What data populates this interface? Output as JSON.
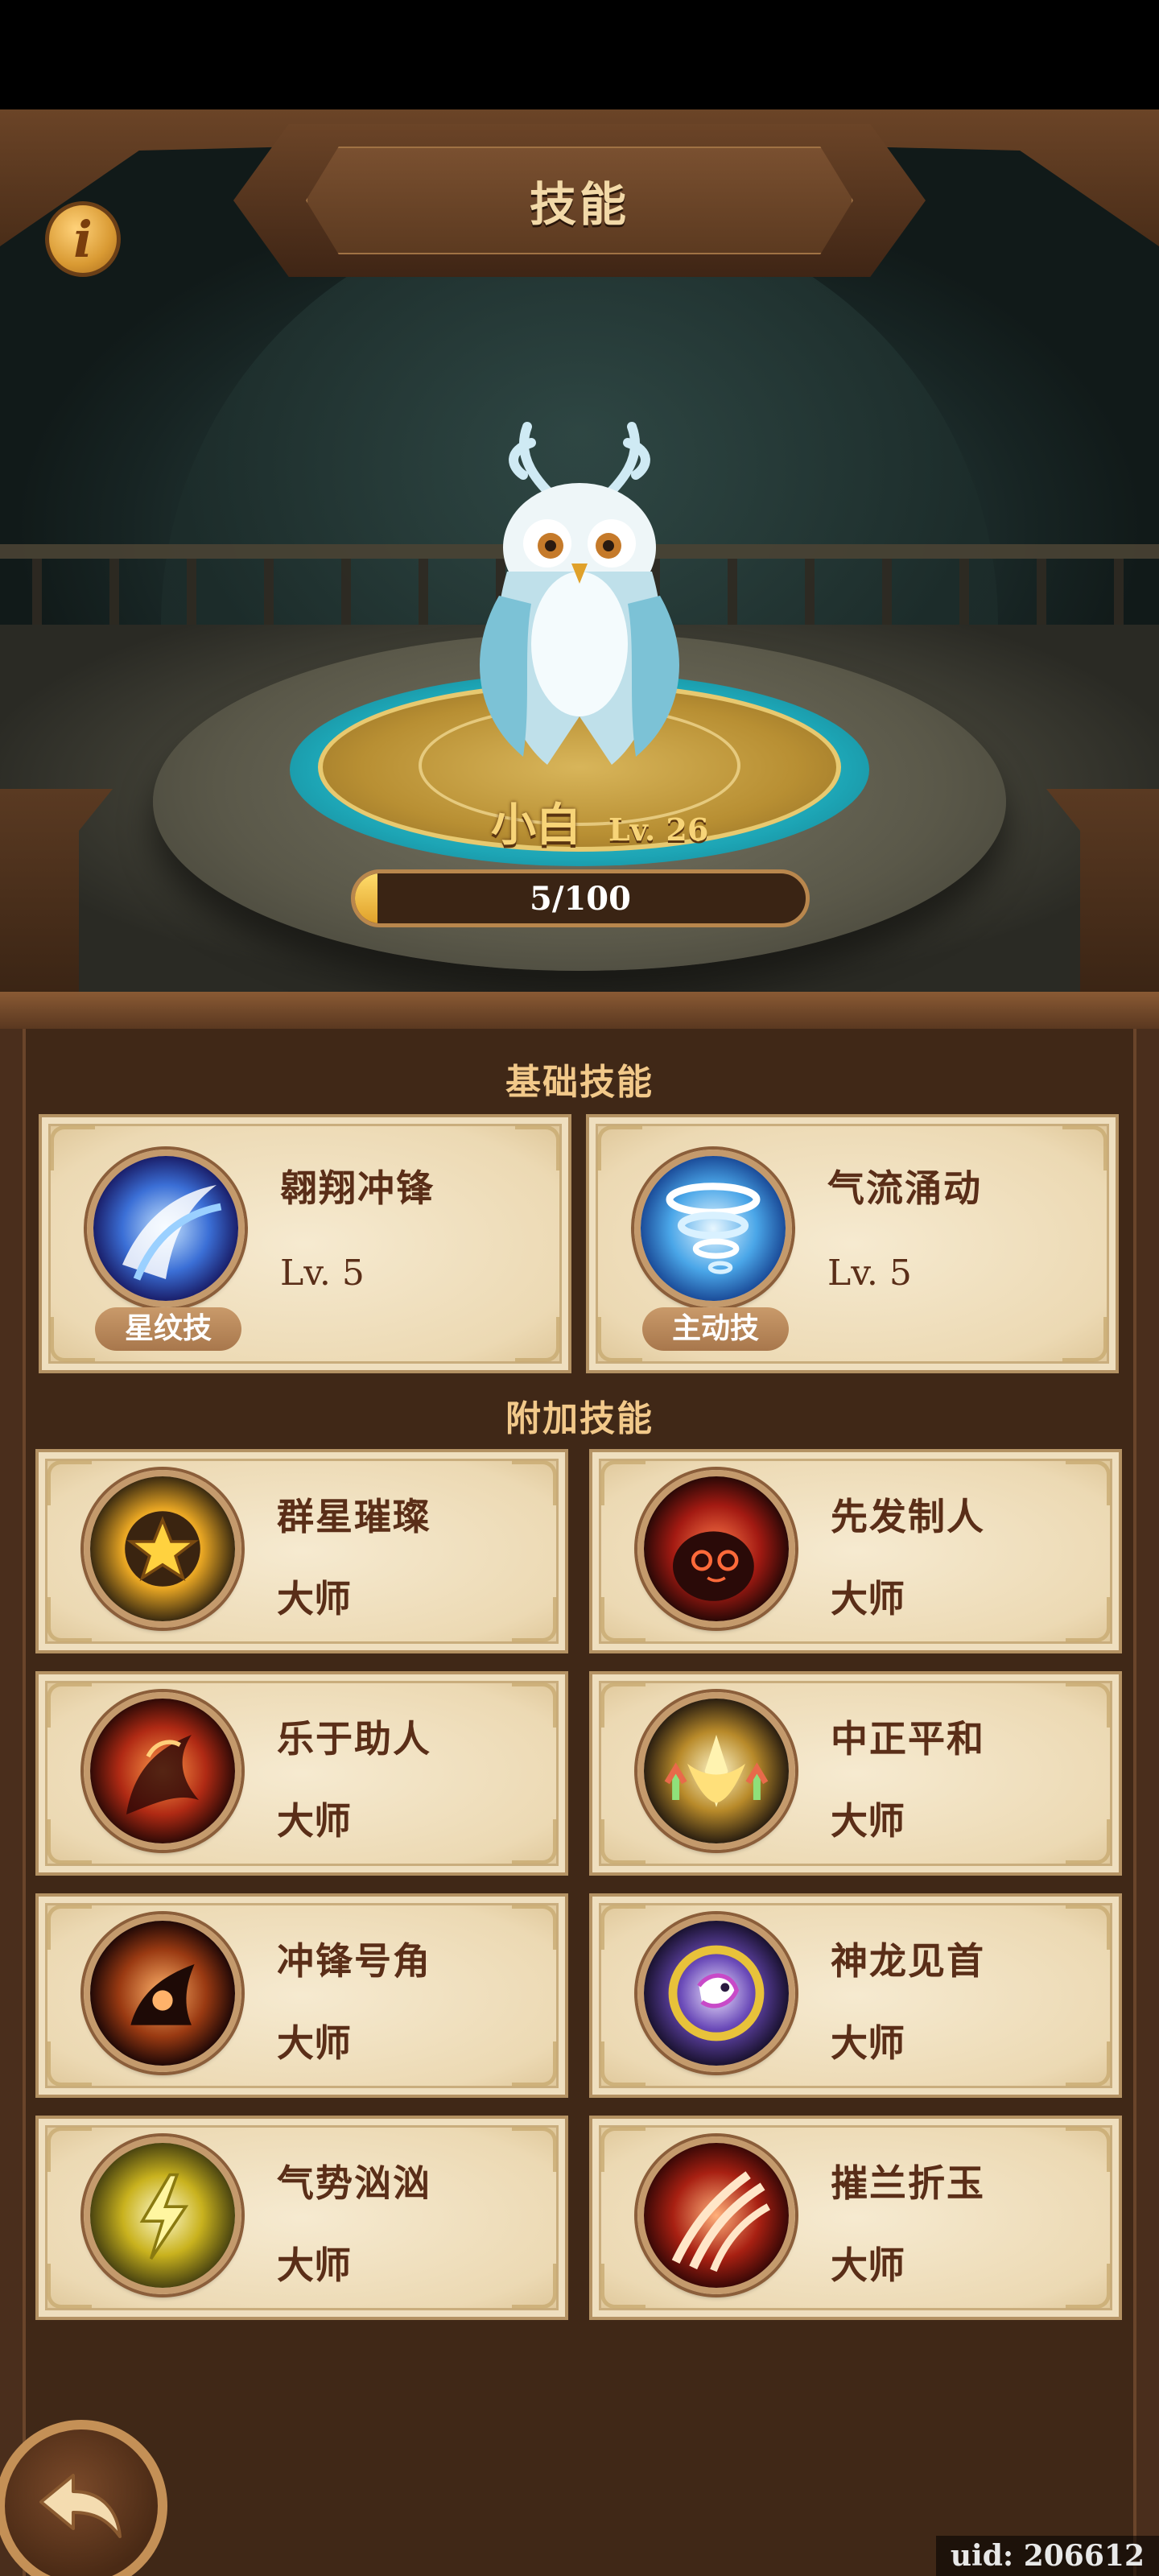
{
  "header": {
    "title": "技能"
  },
  "pet": {
    "name": "小白",
    "level_label": "Lv. 26"
  },
  "exp": {
    "current": 5,
    "max": 100,
    "text": "5/100"
  },
  "sections": {
    "basic_title": "基础技能",
    "extra_title": "附加技能"
  },
  "basic_skills": [
    {
      "name": "翱翔冲锋",
      "level": "Lv. 5",
      "tag": "星纹技",
      "icon": "blue-wave-slash-icon"
    },
    {
      "name": "气流涌动",
      "level": "Lv. 5",
      "tag": "主动技",
      "icon": "tornado-icon"
    }
  ],
  "extra_skills": [
    {
      "name": "群星璀璨",
      "rank": "大师",
      "icon": "gold-star-icon"
    },
    {
      "name": "先发制人",
      "rank": "大师",
      "icon": "red-eyes-icon"
    },
    {
      "name": "乐于助人",
      "rank": "大师",
      "icon": "flame-beast-icon"
    },
    {
      "name": "中正平和",
      "rank": "大师",
      "icon": "golden-lotus-icon"
    },
    {
      "name": "冲锋号角",
      "rank": "大师",
      "icon": "horn-icon"
    },
    {
      "name": "神龙见首",
      "rank": "大师",
      "icon": "dragon-icon"
    },
    {
      "name": "气势汹汹",
      "rank": "大师",
      "icon": "lightning-orb-icon"
    },
    {
      "name": "摧兰折玉",
      "rank": "大师",
      "icon": "claw-slash-icon"
    }
  ],
  "footer": {
    "uid": "uid: 206612"
  },
  "colors": {
    "panel_brown": "#4a2e1c",
    "card_parchment": "#f0e0c0",
    "text_dark_brown": "#5a2e18",
    "gold_text": "#f7d478",
    "section_title": "#f2c98a"
  }
}
